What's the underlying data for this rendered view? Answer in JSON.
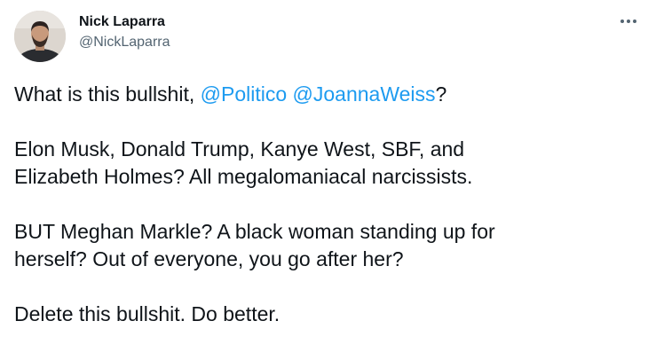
{
  "author": {
    "display_name": "Nick Laparra",
    "handle": "@NickLaparra",
    "avatar_icon": "profile-photo-icon"
  },
  "more_icon": "more-horizontal-icon",
  "colors": {
    "text": "#0f1419",
    "secondary_text": "#536471",
    "mention": "#1d9bf0",
    "background": "#ffffff"
  },
  "tweet": {
    "p1": {
      "before": "What is this bullshit, ",
      "mention1": "@Politico",
      "between": " ",
      "mention2": "@JoannaWeiss",
      "after": "?"
    },
    "p2": {
      "line1": "Elon Musk, Donald Trump, Kanye West, SBF, and",
      "line2": "Elizabeth Holmes? All megalomaniacal narcissists."
    },
    "p3": {
      "line1": "BUT Meghan Markle? A black woman standing up for",
      "line2": "herself? Out of everyone, you go after her?"
    },
    "p4": {
      "line1": "Delete this bullshit. Do better."
    }
  }
}
